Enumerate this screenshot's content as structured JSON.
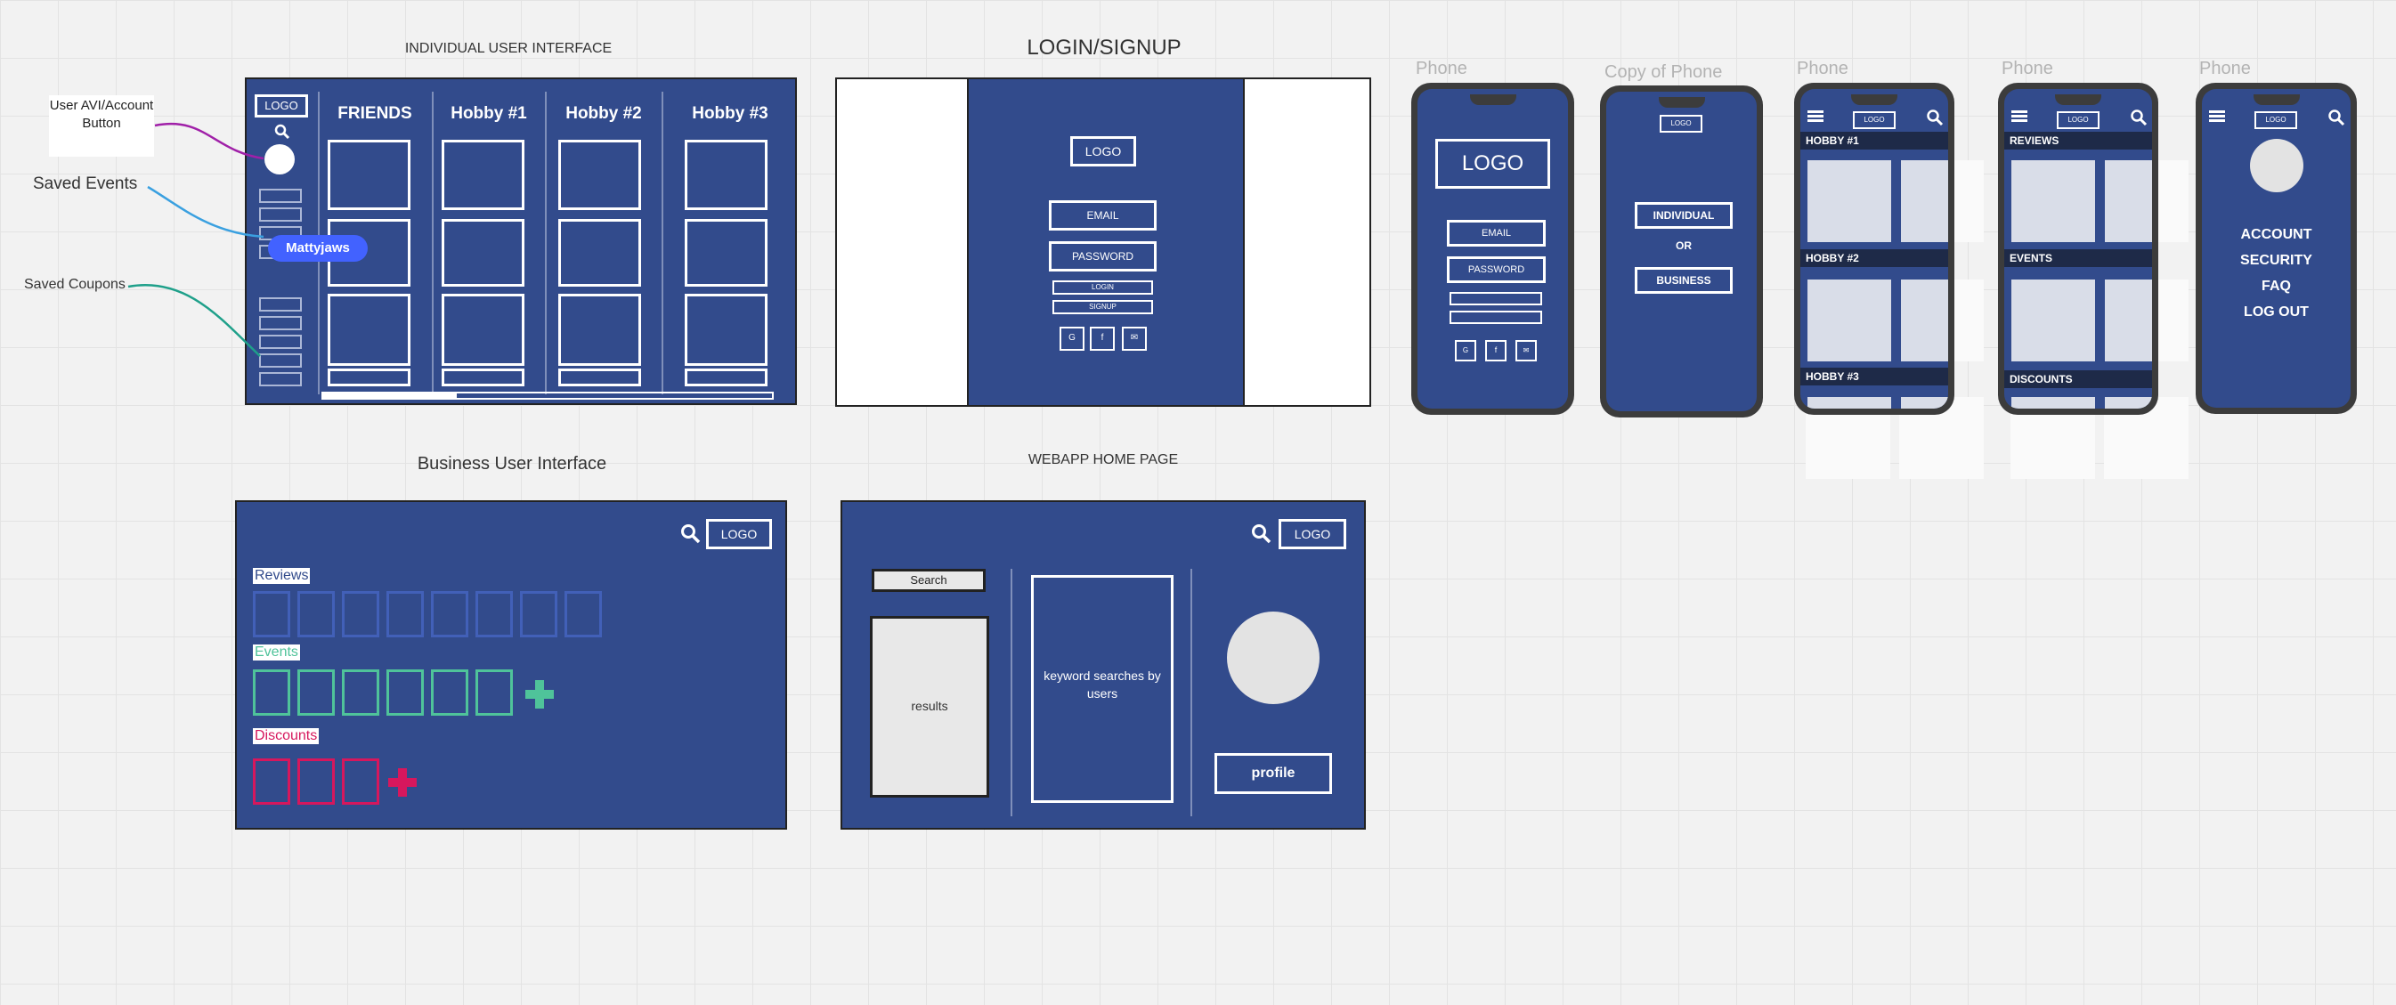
{
  "individual_ui": {
    "title": "INDIVIDUAL USER INTERFACE",
    "logo": "LOGO",
    "columns": [
      "FRIENDS",
      "Hobby #1",
      "Hobby #2",
      "Hobby #3"
    ],
    "cursor_user": "Mattyjaws"
  },
  "annotations": {
    "user_avi": "User AVI/Account Button",
    "saved_events": "Saved Events",
    "saved_coupons": "Saved Coupons"
  },
  "login": {
    "title": "LOGIN/SIGNUP",
    "logo": "LOGO",
    "email": "EMAIL",
    "password": "PASSWORD",
    "login_btn": "LOGIN",
    "signup_btn": "SIGNUP"
  },
  "business_ui": {
    "title": "Business User Interface",
    "logo": "LOGO",
    "reviews": "Reviews",
    "events": "Events",
    "discounts": "Discounts"
  },
  "webapp": {
    "title": "WEBAPP HOME PAGE",
    "logo": "LOGO",
    "search": "Search",
    "results": "results",
    "keyword": "keyword searches by users",
    "profile": "profile"
  },
  "phones": [
    {
      "label": "Phone",
      "logo": "LOGO",
      "email": "EMAIL",
      "password": "PASSWORD"
    },
    {
      "label": "Copy of Phone",
      "logo": "LOGO",
      "individual": "INDIVIDUAL",
      "or": "OR",
      "business": "BUSINESS"
    },
    {
      "label": "Phone",
      "logo": "LOGO",
      "sections": [
        "HOBBY #1",
        "HOBBY #2",
        "HOBBY #3"
      ]
    },
    {
      "label": "Phone",
      "logo": "LOGO",
      "sections": [
        "REVIEWS",
        "EVENTS",
        "DISCOUNTS"
      ]
    },
    {
      "label": "Phone",
      "logo": "LOGO",
      "menu": [
        "ACCOUNT",
        "SECURITY",
        "FAQ",
        "LOG OUT"
      ]
    }
  ],
  "colors": {
    "frame_blue": "#324b8c",
    "events_green": "#4fc39a",
    "discounts_pink": "#d6175d",
    "cursor_blue": "#4262ff"
  }
}
